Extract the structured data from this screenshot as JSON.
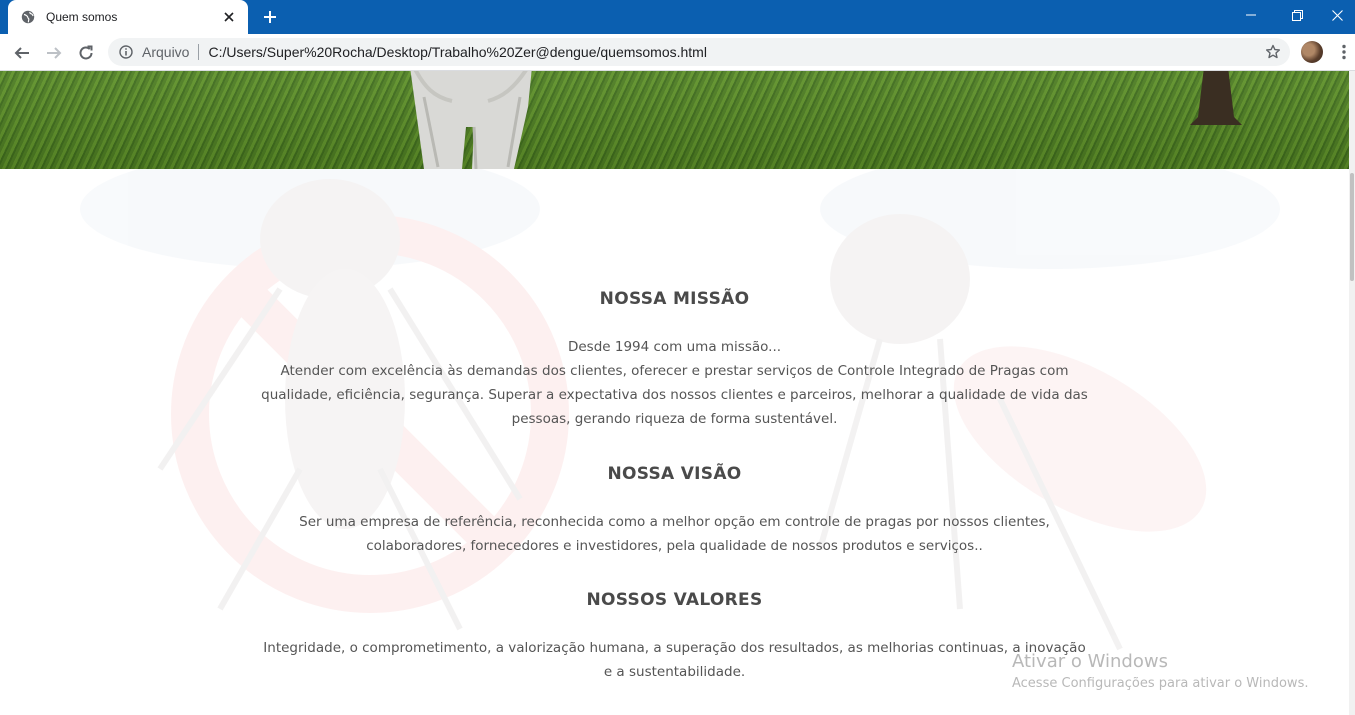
{
  "browser": {
    "tab_title": "Quem somos",
    "omnibox_label": "Arquivo",
    "url": "C:/Users/Super%20Rocha/Desktop/Trabalho%20Zer@dengue/quemsomos.html",
    "accent_color": "#0b5fb0"
  },
  "page": {
    "sections": [
      {
        "title": "NOSSA MISSÃO",
        "lines": [
          "Desde 1994 com uma missão...",
          "Atender com excelência às demandas dos clientes, oferecer e prestar serviços de Controle Integrado de Pragas com",
          "qualidade, eficiência, segurança. Superar a expectativa dos nossos clientes e parceiros, melhorar a qualidade de vida das",
          "pessoas, gerando riqueza de forma sustentável."
        ]
      },
      {
        "title": "NOSSA VISÃO",
        "lines": [
          "Ser uma empresa de referência, reconhecida como a melhor opção em controle de pragas por nossos clientes,",
          "colaboradores, fornecedores e investidores, pela qualidade de nossos produtos e serviços.."
        ]
      },
      {
        "title": "NOSSOS VALORES",
        "lines": [
          "Integridade, o comprometimento, a valorização humana, a superação dos resultados, as melhorias continuas, a inovação",
          "e a sustentabilidade."
        ]
      }
    ]
  },
  "windows_watermark": {
    "title": "Ativar o Windows",
    "subtitle": "Acesse Configurações para ativar o Windows."
  }
}
